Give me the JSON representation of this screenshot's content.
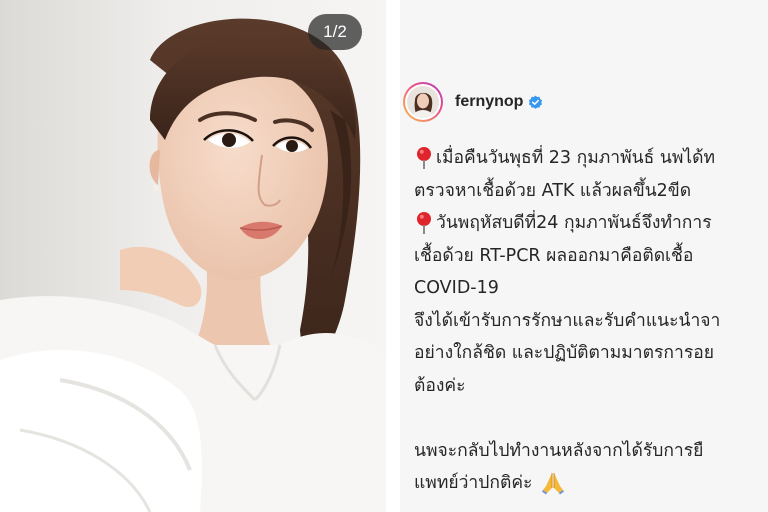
{
  "media": {
    "counter": "1/2",
    "image_subject": "portrait photo of a woman in a white blouse"
  },
  "post": {
    "username": "fernynop",
    "verified": true,
    "caption": {
      "line1": "เมื่อคืนวันพุธที่ 23 กุมภาพันธ์ นพได้ท",
      "line2": "ตรวจหาเชื้อด้วย ATK แล้วผลขึ้น2ขีด",
      "line3": "วันพฤหัสบดีที่24 กุมภาพันธ์จึงทำการ",
      "line4": "เชื้อด้วย RT-PCR ผลออกมาคือติดเชื้อ",
      "line5": "COVID-19",
      "line6": "จึงได้เข้ารับการรักษาและรับคำแนะนำจา",
      "line7": "อย่างใกล้ชิด และปฏิบัติตามมาตรการอย",
      "line8": "ต้องค่ะ",
      "line9": "นพจะกลับไปทำงานหลังจากได้รับการยื",
      "line10": "แพทย์ว่าปกติค่ะ"
    }
  },
  "icons": {
    "pin": "round-pushpin-icon",
    "verified": "verified-badge-icon",
    "pray": "folded-hands-icon"
  },
  "colors": {
    "verified": "#3897f0",
    "pin": "#e0242b",
    "text": "#262626"
  }
}
